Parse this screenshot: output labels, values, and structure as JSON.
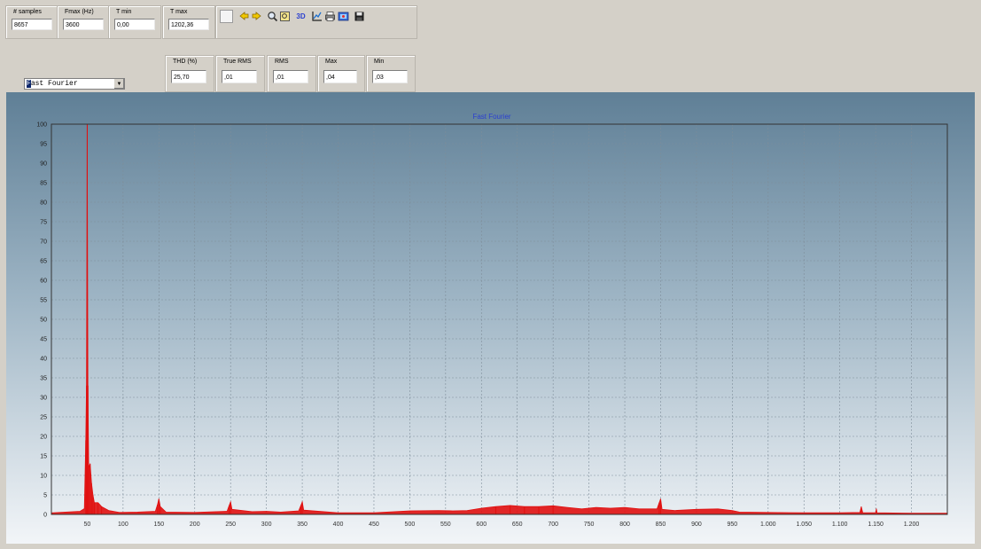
{
  "stats_top": [
    {
      "label": "# samples",
      "value": "8657"
    },
    {
      "label": "Fmax (Hz)",
      "value": "3600"
    },
    {
      "label": "T min",
      "value": "0,00"
    },
    {
      "label": "T max",
      "value": "1202,36"
    }
  ],
  "stats_bottom": [
    {
      "label": "THD (%)",
      "value": "25,70"
    },
    {
      "label": "True RMS",
      "value": ",01"
    },
    {
      "label": "RMS",
      "value": ",01"
    },
    {
      "label": "Max",
      "value": ",04"
    },
    {
      "label": "Min",
      "value": ",03"
    }
  ],
  "analysis_select": {
    "selected": "Fast Fourier"
  },
  "toolbar": {
    "icons": [
      "pointer-icon",
      "pan-left-icon",
      "pan-right-icon",
      "zoom-icon",
      "zoom-box-icon",
      "3d-icon",
      "chart-axes-icon",
      "print-icon",
      "export-icon",
      "save-icon"
    ],
    "three_d_label": "3D"
  },
  "chart_data": {
    "type": "area",
    "title": "Fast Fourier",
    "xlim": [
      0,
      1250
    ],
    "ylim": [
      0,
      100
    ],
    "x_ticks": [
      "50",
      "100",
      "150",
      "200",
      "250",
      "300",
      "350",
      "400",
      "450",
      "500",
      "550",
      "600",
      "650",
      "700",
      "750",
      "800",
      "850",
      "900",
      "950",
      "1.000",
      "1.050",
      "1.100",
      "1.150",
      "1.200"
    ],
    "y_ticks": [
      "0",
      "5",
      "10",
      "15",
      "20",
      "25",
      "30",
      "35",
      "40",
      "45",
      "50",
      "55",
      "60",
      "65",
      "70",
      "75",
      "80",
      "85",
      "90",
      "95",
      "100"
    ],
    "grid": true,
    "color": "#e01010",
    "series": [
      {
        "x": [
          0,
          40,
          46,
          48,
          49,
          50,
          51,
          52,
          54,
          56,
          58,
          60,
          65,
          70,
          80,
          95,
          120,
          145,
          148,
          150,
          152,
          160,
          200,
          245,
          248,
          250,
          252,
          280,
          300,
          320,
          345,
          348,
          350,
          352,
          400,
          450,
          500,
          540,
          560,
          580,
          600,
          620,
          640,
          660,
          680,
          700,
          720,
          740,
          760,
          780,
          800,
          820,
          845,
          848,
          850,
          852,
          870,
          900,
          930,
          950,
          960,
          1000,
          1050,
          1100,
          1128,
          1130,
          1132,
          1150,
          1151,
          1152,
          1200,
          1250
        ],
        "y": [
          0.4,
          0.8,
          1.5,
          19,
          33,
          100,
          33,
          12,
          13,
          8,
          5,
          3,
          3,
          2,
          1,
          0.5,
          0.6,
          0.8,
          2.5,
          4,
          2,
          0.6,
          0.5,
          0.8,
          2.3,
          3.2,
          1.3,
          0.7,
          0.8,
          0.6,
          0.9,
          2.3,
          3.2,
          1.1,
          0.4,
          0.4,
          0.9,
          1.0,
          0.9,
          1.0,
          1.6,
          2.0,
          2.3,
          2.0,
          2.0,
          2.2,
          1.8,
          1.4,
          1.8,
          1.6,
          1.8,
          1.4,
          1.4,
          3.0,
          4.0,
          1.3,
          1.0,
          1.3,
          1.4,
          1.0,
          0.6,
          0.5,
          0.4,
          0.4,
          0.5,
          2.0,
          0.4,
          0.4,
          1.5,
          0.4,
          0.3,
          0.3
        ]
      }
    ]
  }
}
